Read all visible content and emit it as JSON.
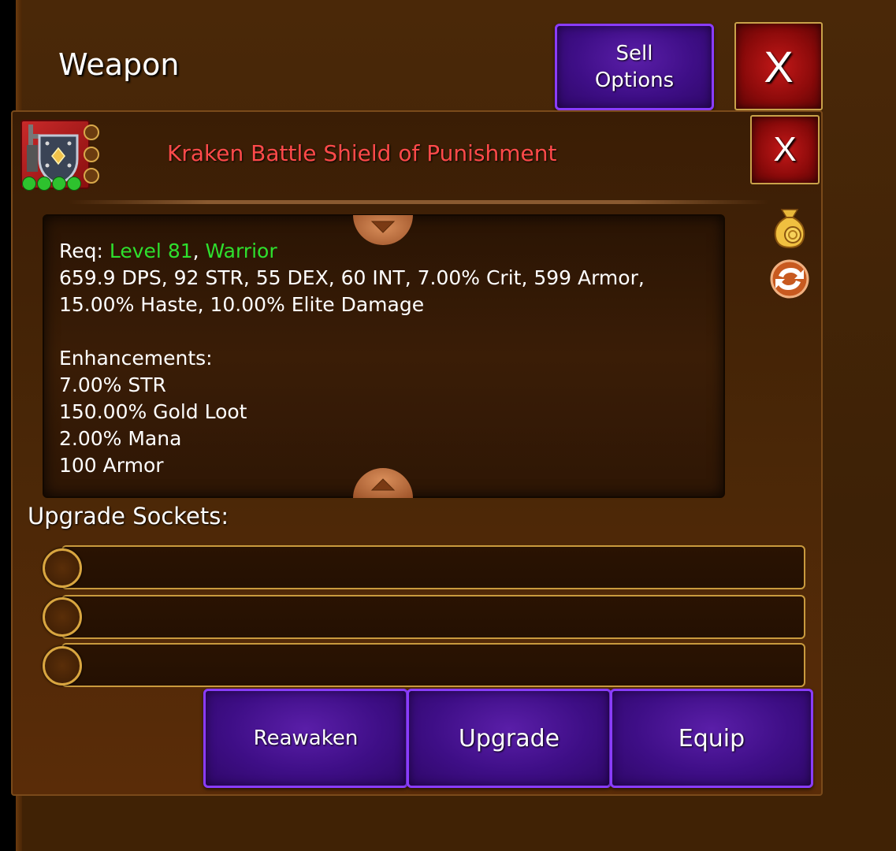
{
  "header": {
    "title": "Weapon",
    "sell_options_label": "Sell\nOptions",
    "close_label": "X"
  },
  "item": {
    "name": "Kraken Battle Shield of Punishment",
    "name_color": "#ff4a4a",
    "icon": "shield-icon",
    "gem_slots": 3,
    "rank_stars": 4,
    "close_label": "X"
  },
  "stats": {
    "req_label": "Req: ",
    "req_level": "Level 81",
    "req_sep": ", ",
    "req_class": "Warrior",
    "line1": "659.9 DPS, 92 STR, 55 DEX, 60 INT, 7.00% Crit, 599 Armor,",
    "line2": "15.00% Haste, 10.00% Elite Damage",
    "enhancements_title": "Enhancements:",
    "enhancements": [
      "7.00% STR",
      "150.00% Gold Loot",
      "2.00% Mana",
      "100 Armor"
    ]
  },
  "side_icons": [
    "gold-bag-icon",
    "refresh-arrows-icon"
  ],
  "upgrade": {
    "label": "Upgrade Sockets:",
    "sockets": 3
  },
  "actions": {
    "reawaken": "Reawaken",
    "upgrade": "Upgrade",
    "equip": "Equip"
  },
  "colors": {
    "accent_purple": "#3e0e86",
    "close_red": "#8a0a0a",
    "requirement_green": "#2ee02e"
  }
}
